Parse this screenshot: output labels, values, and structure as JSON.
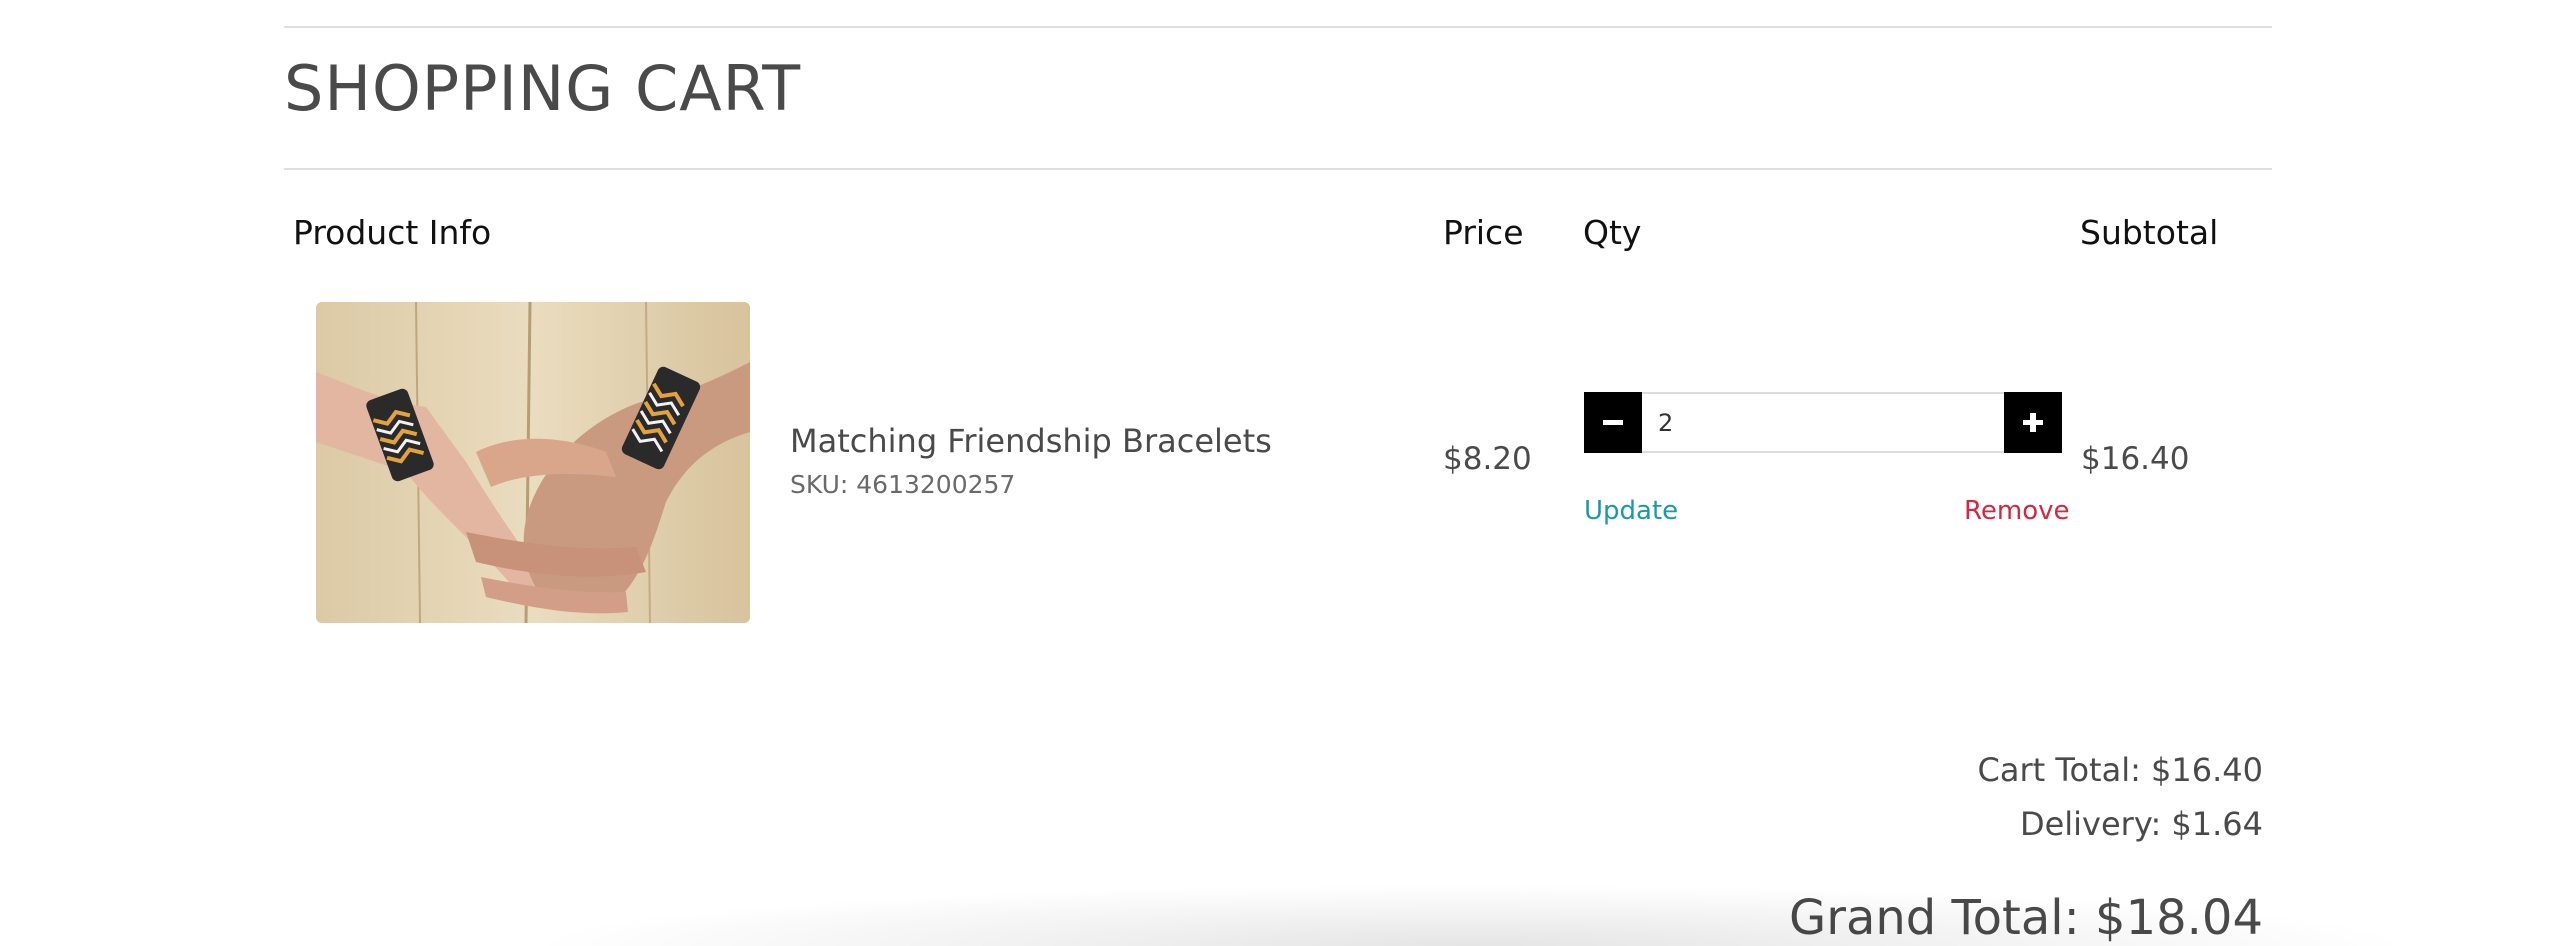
{
  "page": {
    "title": "SHOPPING CART"
  },
  "table": {
    "headers": {
      "product": "Product Info",
      "price": "Price",
      "qty": "Qty",
      "subtotal": "Subtotal"
    },
    "items": [
      {
        "name": "Matching Friendship Bracelets",
        "sku_label": "SKU:",
        "sku": "4613200257",
        "price": "$8.20",
        "quantity": "2",
        "subtotal": "$16.40",
        "update_label": "Update",
        "remove_label": "Remove",
        "image": "photo-two-hands-wearing-woven-friendship-bracelets"
      }
    ]
  },
  "summary": {
    "cart_total": "Cart Total: $16.40",
    "delivery": "Delivery: $1.64",
    "grand_total": "Grand Total: $18.04"
  },
  "icons": {
    "decrease": "minus-icon",
    "increase": "plus-icon"
  },
  "colors": {
    "text": "#4a4a4a",
    "heading_text": "#111111",
    "update_link": "#1a9aa6",
    "remove_link": "#d7263d",
    "qty_button_bg": "#000000",
    "divider": "#dedede"
  }
}
